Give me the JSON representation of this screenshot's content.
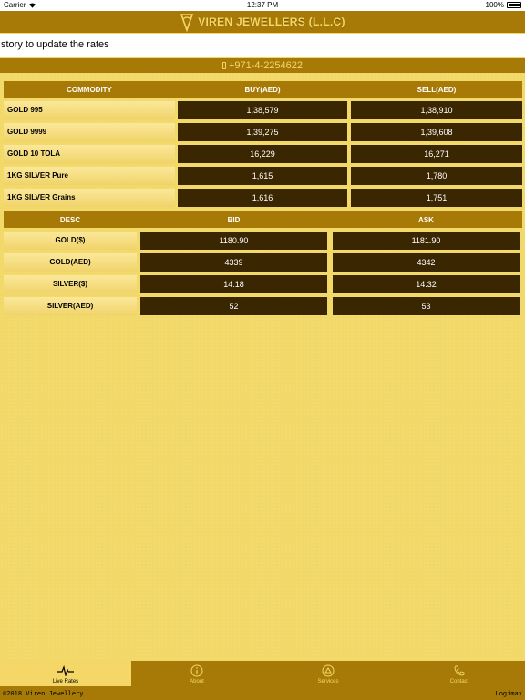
{
  "status_bar": {
    "carrier": "Carrier",
    "time": "12:37 PM",
    "battery": "100%"
  },
  "header": {
    "title": "VIREN JEWELLERS (L.L.C)"
  },
  "ticker": {
    "text": "story to update the rates"
  },
  "phone": {
    "icon": "phone-icon",
    "number": "+971-4-2254622"
  },
  "commodity_table": {
    "headers": [
      "COMMODITY",
      "BUY(AED)",
      "SELL(AED)"
    ],
    "rows": [
      {
        "name": "GOLD 995",
        "buy": "1,38,579",
        "sell": "1,38,910"
      },
      {
        "name": "GOLD 9999",
        "buy": "1,39,275",
        "sell": "1,39,608"
      },
      {
        "name": "GOLD 10 TOLA",
        "buy": "16,229",
        "sell": "16,271"
      },
      {
        "name": "1KG SILVER Pure",
        "buy": "1,615",
        "sell": "1,780"
      },
      {
        "name": "1KG SILVER Grains",
        "buy": "1,616",
        "sell": "1,751"
      }
    ]
  },
  "spot_table": {
    "headers": [
      "DESC",
      "BID",
      "ASK"
    ],
    "rows": [
      {
        "name": "GOLD($)",
        "bid": "1180.90",
        "ask": "1181.90"
      },
      {
        "name": "GOLD(AED)",
        "bid": "4339",
        "ask": "4342"
      },
      {
        "name": "SILVER($)",
        "bid": "14.18",
        "ask": "14.32"
      },
      {
        "name": "SILVER(AED)",
        "bid": "52",
        "ask": "53"
      }
    ]
  },
  "tabs": [
    {
      "label": "Live Rates",
      "icon": "pulse-icon",
      "active": true
    },
    {
      "label": "About",
      "icon": "info-icon",
      "active": false
    },
    {
      "label": "Services",
      "icon": "services-icon",
      "active": false
    },
    {
      "label": "Contact",
      "icon": "phone-icon",
      "active": false
    }
  ],
  "footer": {
    "copyright": "©2018 Viren Jewellery",
    "brand": "Logimax"
  },
  "colors": {
    "brand_brown": "#a77a08",
    "gold_text": "#f4d766",
    "value_bg": "#3a2702",
    "page_bg": "#f1d867"
  }
}
